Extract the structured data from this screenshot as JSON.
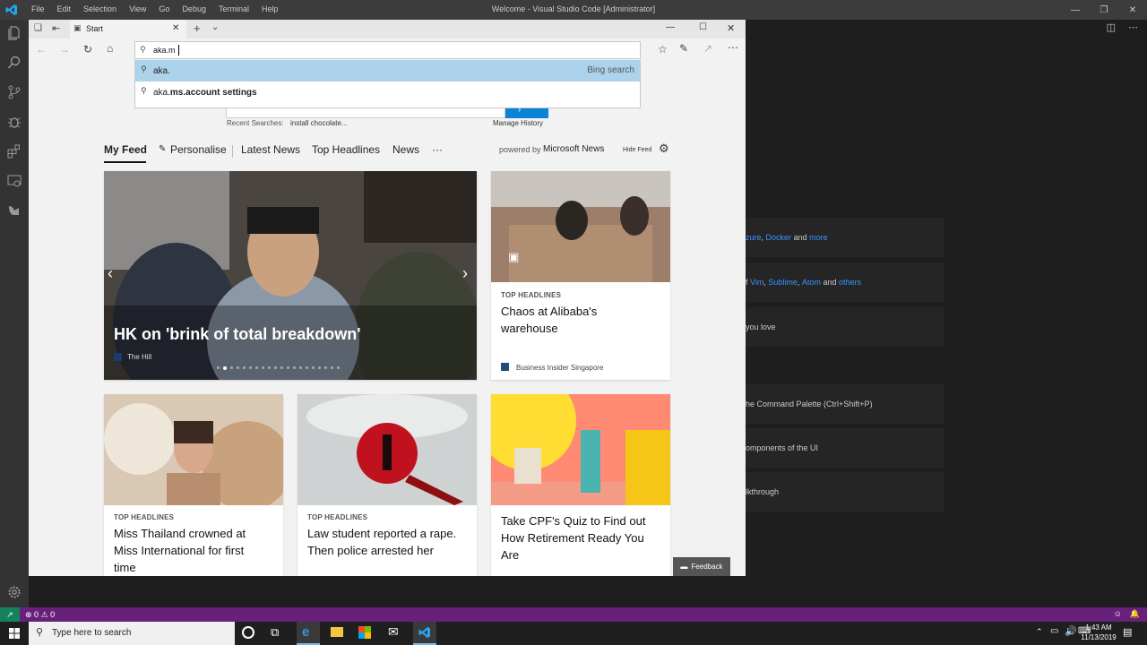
{
  "vscode": {
    "menu": [
      "File",
      "Edit",
      "Selection",
      "View",
      "Go",
      "Debug",
      "Terminal",
      "Help"
    ],
    "window_title": "Welcome - Visual Studio Code [Administrator]",
    "welcome_rows": [
      {
        "pre": "",
        "links": [
          "zure",
          "Docker"
        ],
        "mid": "and",
        "last_link": "more"
      },
      {
        "pre": "f",
        "links": [
          "Vim",
          "Sublime",
          "Atom"
        ],
        "mid": "and",
        "last_link": "others"
      },
      {
        "text": "you love"
      },
      {
        "text": "he Command Palette (Ctrl+Shift+P)"
      },
      {
        "text": "omponents of the UI"
      },
      {
        "text": "lkthrough"
      }
    ],
    "status": {
      "errors": "0",
      "warnings": "0"
    }
  },
  "edge": {
    "tab_title": "Start",
    "address_value": "aka.m",
    "suggestions": [
      {
        "text_plain": "aka.",
        "text_bold": "",
        "right": "Bing search"
      },
      {
        "text_plain": "aka.",
        "text_bold": "ms.account settings",
        "right": ""
      }
    ],
    "recent_searches_label": "Recent Searches:",
    "recent_searches_value": "install chocolate...",
    "manage_history": "Manage History",
    "feed_tabs": [
      "My Feed",
      "Personalise",
      "Latest News",
      "Top Headlines",
      "News",
      "···"
    ],
    "powered_by": "powered by",
    "powered_brand": "Microsoft News",
    "hide_feed": "Hide Feed",
    "hero": {
      "headline": "HK on 'brink of total breakdown'",
      "source": "The Hill"
    },
    "side_card": {
      "category": "TOP HEADLINES",
      "headline": "Chaos at Alibaba's warehouse",
      "source": "Business Insider Singapore"
    },
    "cards": [
      {
        "category": "TOP HEADLINES",
        "headline": "Miss Thailand crowned at Miss International for first time"
      },
      {
        "category": "TOP HEADLINES",
        "headline": "Law student reported a rape. Then police arrested her"
      },
      {
        "category": "",
        "headline": "Take CPF's Quiz to Find out How Retirement Ready You Are"
      }
    ],
    "feedback": "Feedback"
  },
  "taskbar": {
    "search_placeholder": "Type here to search",
    "time": "1:43 AM",
    "date": "11/13/2019"
  },
  "colors": {
    "statusbar": "#68217a",
    "vscode_bg": "#1e1e1e",
    "edge_bg": "#f2f2f2",
    "selection": "#add3ec",
    "link": "#3794ff"
  }
}
